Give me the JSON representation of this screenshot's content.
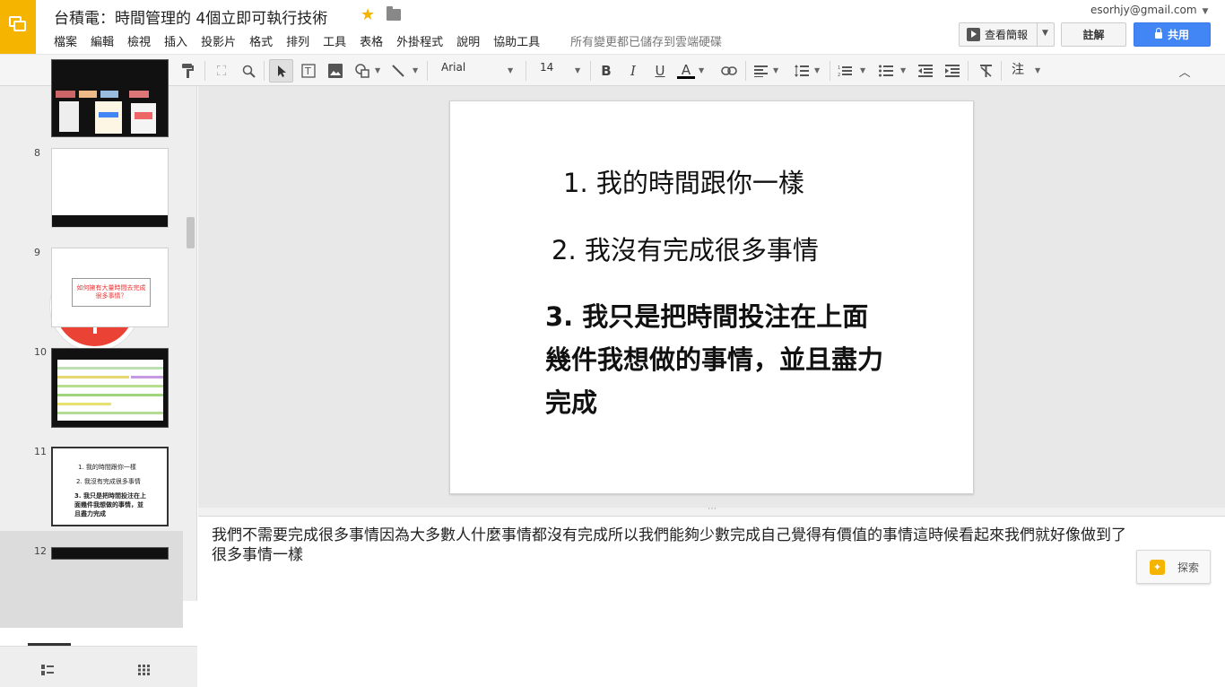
{
  "app": {
    "title": "台積電：時間管理的 4個立即可執行技術",
    "saved_status": "所有變更都已儲存到雲端硬碟",
    "account": "esorhjy@gmail.com",
    "star_icon": "★"
  },
  "menu": [
    "檔案",
    "編輯",
    "檢視",
    "插入",
    "投影片",
    "格式",
    "排列",
    "工具",
    "表格",
    "外掛程式",
    "說明",
    "協助工具"
  ],
  "header_buttons": {
    "present": "查看簡報",
    "comment": "註解",
    "share": "共用"
  },
  "toolbar": {
    "font": "Arial",
    "size": "14",
    "comment_tool": "注"
  },
  "thumbnails": {
    "numbers": [
      "8",
      "9",
      "10",
      "11",
      "12"
    ],
    "slide9_text": "如何擁有大量時間去完成很多事情？",
    "slide11_lines": [
      "1. 我的時間跟你一樣",
      "2. 我沒有完成很多事情",
      "3. 我只是把時間投注在上面幾件我想做的事情，並且盡力完成"
    ]
  },
  "slide": {
    "line1": "1. 我的時間跟你一樣",
    "line2": "2. 我沒有完成很多事情",
    "line3": "3. 我只是把時間投注在上面幾件我想做的事情，並且盡力完成"
  },
  "notes": {
    "text": "我們不需要完成很多事情因為大多數人什麼事情都沒有完成所以我們能夠少數完成自己覺得有價值的事情這時候看起來我們就好像做到了很多事情一樣",
    "explore_label": "探索"
  },
  "colors": {
    "accent": "#4285f4",
    "brand": "#f4b400",
    "mic": "#ea4335"
  }
}
